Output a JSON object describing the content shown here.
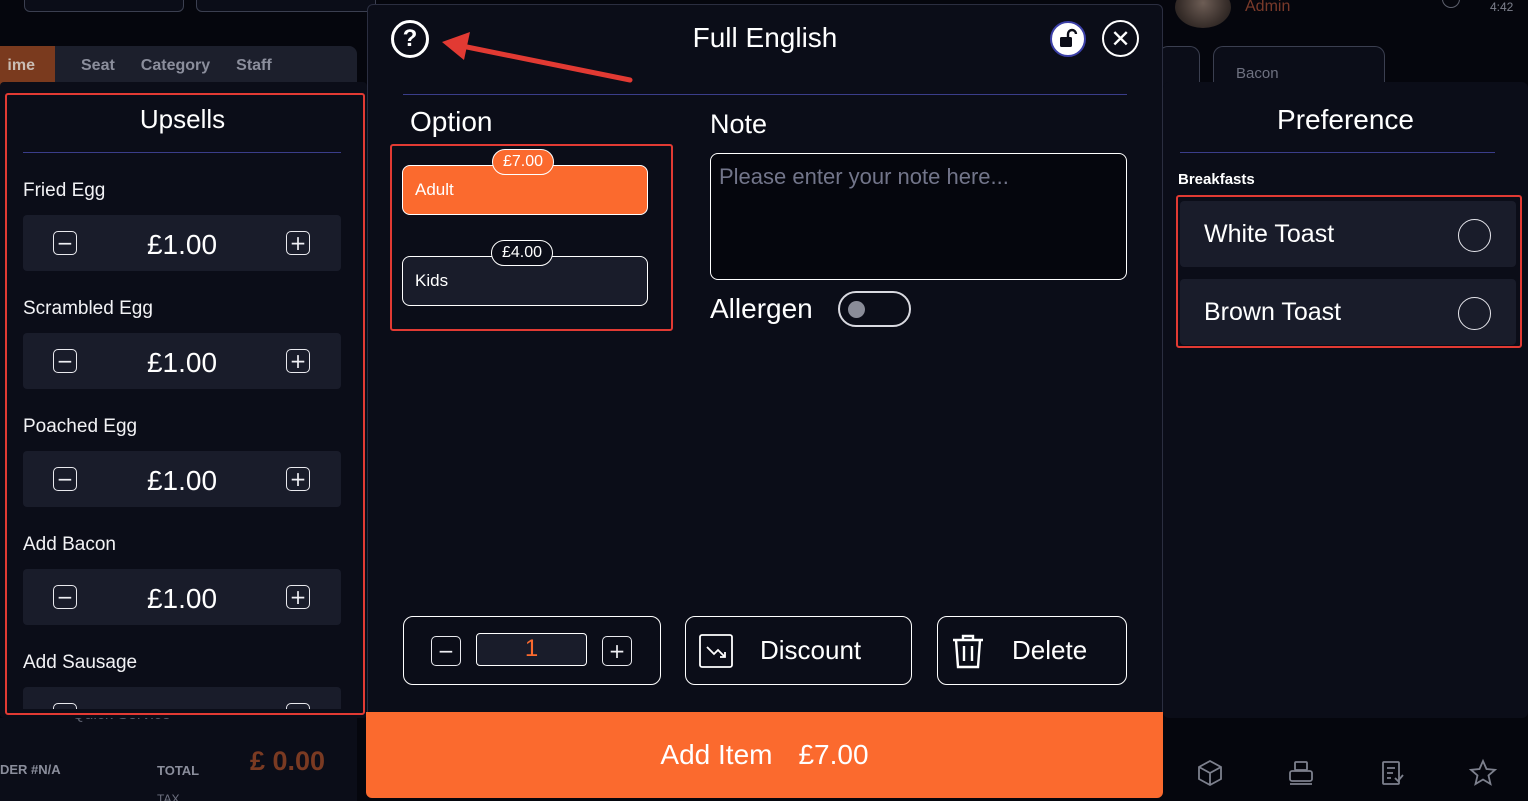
{
  "background": {
    "tabs": [
      "ime",
      "Seat",
      "Category",
      "Staff"
    ],
    "user_role": "Admin",
    "clock": "4:42",
    "category_tab": "Bacon",
    "order_label": "DER #N/A",
    "total_label": "TOTAL",
    "total_amount": "£ 0.00",
    "tax_label": "TAX",
    "service_label": "Quick Service",
    "bottom_icons": [
      "cube-icon",
      "register-icon",
      "receipt-icon",
      "star-icon"
    ]
  },
  "upsells": {
    "title": "Upsells",
    "items": [
      {
        "label": "Fried Egg",
        "price": "£1.00"
      },
      {
        "label": "Scrambled Egg",
        "price": "£1.00"
      },
      {
        "label": "Poached Egg",
        "price": "£1.00"
      },
      {
        "label": "Add Bacon",
        "price": "£1.00"
      },
      {
        "label": "Add Sausage",
        "price": ""
      }
    ]
  },
  "modal": {
    "title": "Full English",
    "option_heading": "Option",
    "options": [
      {
        "label": "Adult",
        "price": "£7.00",
        "selected": true
      },
      {
        "label": "Kids",
        "price": "£4.00",
        "selected": false
      }
    ],
    "note_heading": "Note",
    "note_placeholder": "Please enter your note here...",
    "note_value": "",
    "allergen_label": "Allergen",
    "allergen_on": false,
    "quantity": "1",
    "discount_label": "Discount",
    "delete_label": "Delete",
    "add_item_label": "Add Item",
    "add_item_price": "£7.00"
  },
  "preference": {
    "title": "Preference",
    "group": "Breakfasts",
    "items": [
      {
        "label": "White Toast",
        "checked": false
      },
      {
        "label": "Brown Toast",
        "checked": false
      }
    ]
  },
  "colors": {
    "accent": "#fb6a2e",
    "panel": "#0b0d18",
    "card": "#191c2a",
    "annotation_red": "#e23a33"
  }
}
